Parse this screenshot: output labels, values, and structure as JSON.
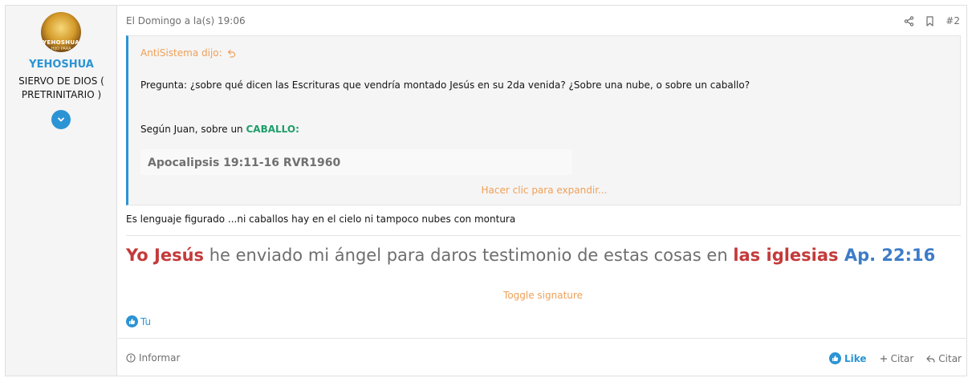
{
  "user": {
    "avatar_text": "YEHOSHUA",
    "avatar_subtext": "HIJO PARA",
    "name": "YEHOSHUA",
    "title": "SIERVO DE DIOS ( PRETRINITARIO )"
  },
  "post": {
    "date": "El Domingo a la(s) 19:06",
    "number": "#2",
    "quote": {
      "author": "AntiSistema dijo:",
      "line1": "Pregunta: ¿sobre qué dicen las Escrituras que vendría montado Jesús en su 2da venida? ¿Sobre una nube, o sobre un caballo?",
      "line2_prefix": "Según Juan, sobre un ",
      "line2_emph": "CABALLO:",
      "scripture": "Apocalipsis 19:11-16 RVR1960",
      "expand": "Hacer clic para expandir..."
    },
    "body": "Es lenguaje figurado ...ni caballos hay en el cielo ni tampoco nubes con montura",
    "signature": {
      "part1": "Yo Jesús",
      "part2": " he enviado mi ángel para daros testimonio de estas cosas en ",
      "part3": "las iglesias",
      "part4": " Ap. 22:16"
    },
    "toggle_signature": "Toggle signature",
    "reaction_user": "Tu"
  },
  "footer": {
    "report": "Informar",
    "like": "Like",
    "quote_add": "Citar",
    "reply_quote": "Citar"
  },
  "colors": {
    "accent": "#2b94d4",
    "link_orange": "#f0a057",
    "red": "#c43a3a",
    "green": "#1f9e6a"
  }
}
